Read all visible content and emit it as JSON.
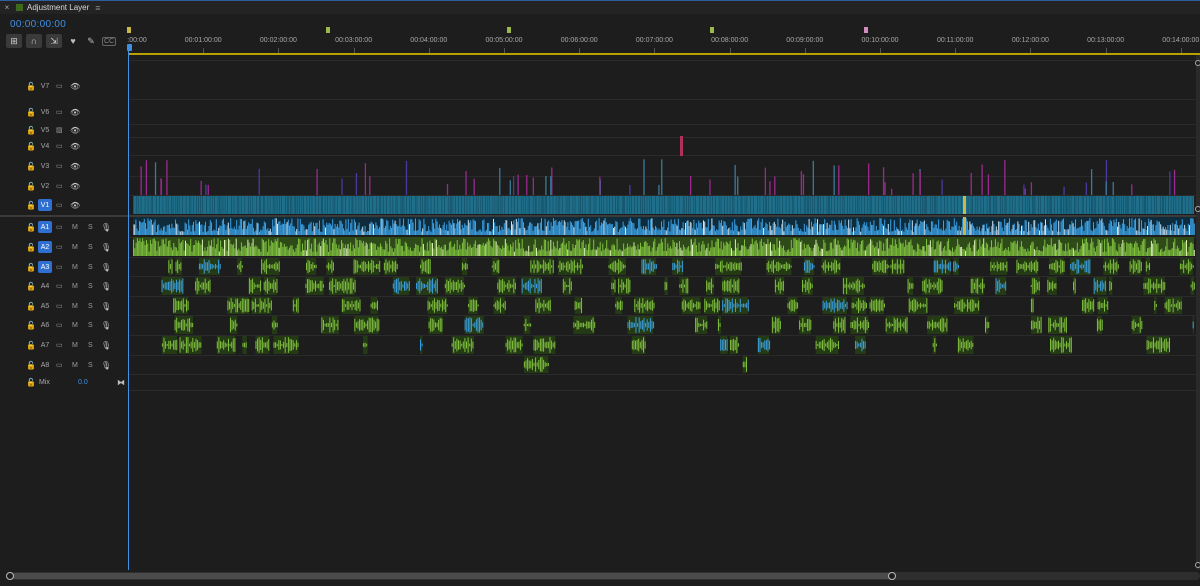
{
  "tab": {
    "close_glyph": "×",
    "title": "Adjustment Layer",
    "menu_glyph": "≡",
    "swatch_color": "#3e6a1e"
  },
  "timecode": "00:00:00:00",
  "tools": [
    {
      "name": "snap-nest-icon",
      "glyph": "⊞"
    },
    {
      "name": "snap-icon",
      "glyph": "∩"
    },
    {
      "name": "linked-selection-icon",
      "glyph": "⇲"
    },
    {
      "name": "add-marker-icon",
      "glyph": "♥"
    },
    {
      "name": "wrench-icon",
      "glyph": "✎"
    },
    {
      "name": "captions-icon",
      "glyph": "CC"
    }
  ],
  "ruler": {
    "labels": [
      ":00:00",
      "00:01:00:00",
      "00:02:00:00",
      "00:03:00:00",
      "00:04:00:00",
      "00:05:00:00",
      "00:06:00:00",
      "00:07:00:00",
      "00:08:00:00",
      "00:09:00:00",
      "00:10:00:00",
      "00:11:00:00",
      "00:12:00:00",
      "00:13:00:00",
      "00:14:00:00"
    ],
    "markers": [
      {
        "minute": 0.0,
        "color": "#c9b84a"
      },
      {
        "minute": 2.65,
        "color": "#9db84a"
      },
      {
        "minute": 5.05,
        "color": "#9db84a"
      },
      {
        "minute": 7.75,
        "color": "#9db84a"
      },
      {
        "minute": 9.8,
        "color": "#d48bbd"
      }
    ]
  },
  "video_tracks": [
    {
      "name": "V7",
      "lock": "🔓",
      "toggle": "▭",
      "eye": "👁",
      "active": false
    },
    {
      "name": "V6",
      "lock": "🔓",
      "toggle": "▭",
      "eye": "👁",
      "active": false
    },
    {
      "name": "V5",
      "lock": "🔓",
      "toggle": "▨",
      "eye": "👁",
      "active": false
    },
    {
      "name": "V4",
      "lock": "🔓",
      "toggle": "▭",
      "eye": "👁",
      "active": false
    },
    {
      "name": "V3",
      "lock": "🔓",
      "toggle": "▭",
      "eye": "👁",
      "active": false
    },
    {
      "name": "V2",
      "lock": "🔓",
      "toggle": "▭",
      "eye": "👁",
      "active": false
    },
    {
      "name": "V1",
      "lock": "🔓",
      "toggle": "▭",
      "eye": "👁",
      "active": true
    }
  ],
  "audio_tracks": [
    {
      "name": "A1",
      "lock": "🔓",
      "toggle": "▭",
      "m": "M",
      "s": "S",
      "mic": "🎙",
      "active": true
    },
    {
      "name": "A2",
      "lock": "🔓",
      "toggle": "▭",
      "m": "M",
      "s": "S",
      "mic": "🎙",
      "active": true
    },
    {
      "name": "A3",
      "lock": "🔓",
      "toggle": "▭",
      "m": "M",
      "s": "S",
      "mic": "🎙",
      "active": true
    },
    {
      "name": "A4",
      "lock": "🔓",
      "toggle": "▭",
      "m": "M",
      "s": "S",
      "mic": "🎙",
      "active": false
    },
    {
      "name": "A5",
      "lock": "🔓",
      "toggle": "▭",
      "m": "M",
      "s": "S",
      "mic": "🎙",
      "active": false
    },
    {
      "name": "A6",
      "lock": "🔓",
      "toggle": "▭",
      "m": "M",
      "s": "S",
      "mic": "🎙",
      "active": false
    },
    {
      "name": "A7",
      "lock": "🔓",
      "toggle": "▭",
      "m": "M",
      "s": "S",
      "mic": "🎙",
      "active": false
    },
    {
      "name": "A8",
      "lock": "🔓",
      "toggle": "▭",
      "m": "M",
      "s": "S",
      "mic": "🎙",
      "active": false
    }
  ],
  "mix": {
    "lock": "🔓",
    "label": "Mix",
    "value": "0.0",
    "end_glyph": "⧓"
  },
  "colors": {
    "accent_blue": "#3f8fe3",
    "video_clip": "#1f6f8b",
    "adjustment_clip": "#9a2a8e",
    "audio_green": "#7fbf3f",
    "audio_blue": "#3aa0e0",
    "work_area": "#b8a200"
  }
}
